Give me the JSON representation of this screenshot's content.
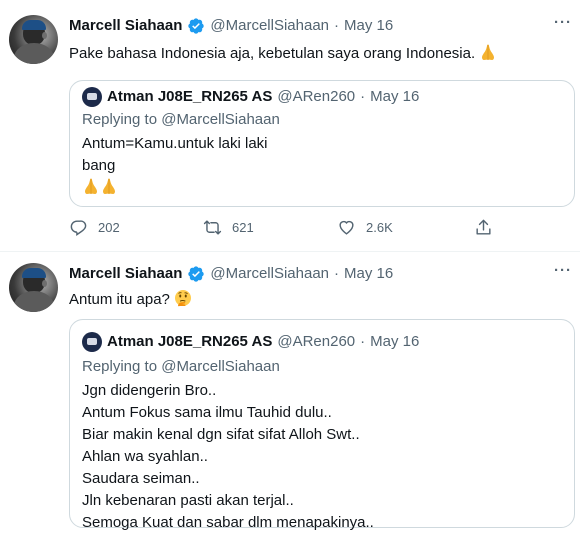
{
  "tweets": [
    {
      "author": "Marcell Siahaan",
      "handle": "@MarcellSiahaan",
      "separator": "·",
      "date": "May 16",
      "more": "···",
      "text": "Pake bahasa Indonesia aja, kebetulan saya orang Indonesia.",
      "text_emoji": "folded-hands",
      "quote": {
        "author": "Atman J08E_RN265 AS",
        "handle": "@ARen260",
        "separator": "·",
        "date": "May 16",
        "replying_to": "Replying to @MarcellSiahaan",
        "lines": [
          "Antum=Kamu.untuk laki laki",
          "bang"
        ],
        "emoji": "folded-hands-x2"
      },
      "actions": {
        "replies": "202",
        "retweets": "621",
        "likes": "2.6K",
        "share": ""
      }
    },
    {
      "author": "Marcell Siahaan",
      "handle": "@MarcellSiahaan",
      "separator": "·",
      "date": "May 16",
      "more": "···",
      "text": "Antum itu apa?",
      "text_emoji": "thinking-face",
      "quote": {
        "author": "Atman J08E_RN265 AS",
        "handle": "@ARen260",
        "separator": "·",
        "date": "May 16",
        "replying_to": "Replying to @MarcellSiahaan",
        "lines": [
          "Jgn didengerin Bro..",
          "Antum Fokus sama ilmu Tauhid dulu..",
          "Biar makin kenal dgn sifat sifat  Alloh Swt..",
          "Ahlan wa syahlan..",
          "Saudara seiman..",
          "Jln kebenaran pasti akan terjal..",
          "Semoga Kuat dan sabar dlm menapakinya.."
        ]
      }
    }
  ],
  "colors": {
    "text": "#0f1419",
    "secondary": "#536471",
    "verified": "#1d9bf0",
    "border": "#cfd9de"
  }
}
